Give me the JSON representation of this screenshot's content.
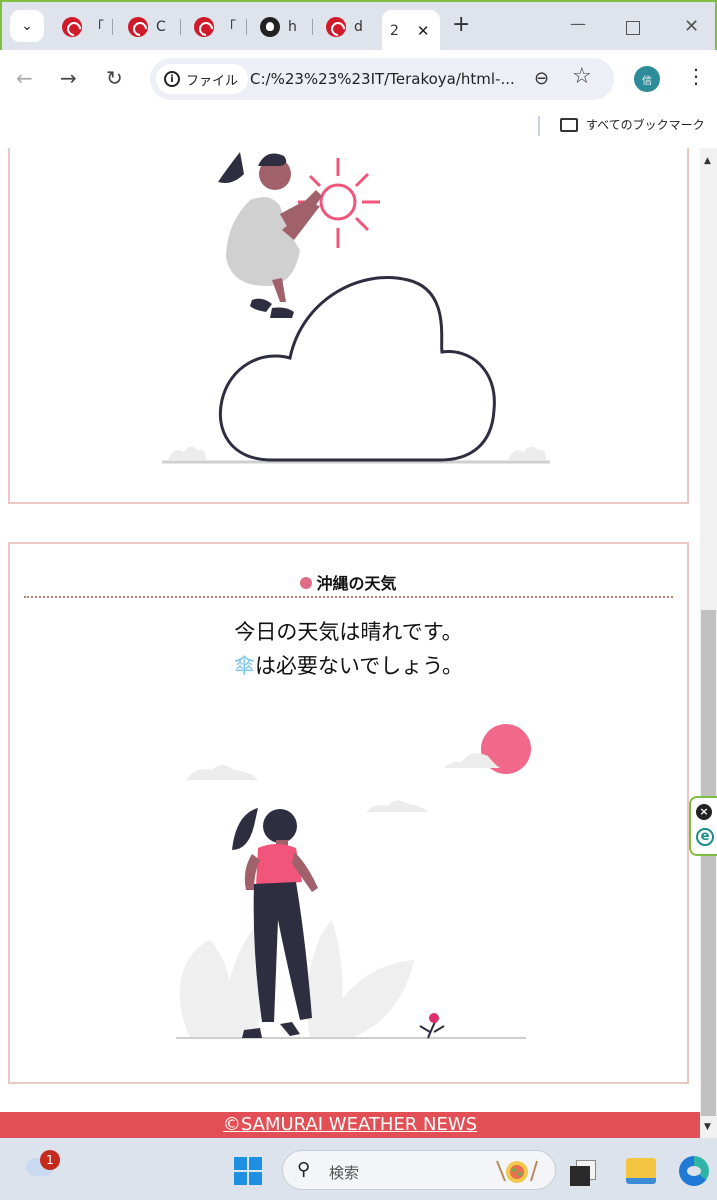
{
  "browser": {
    "tabs": [
      {
        "icon": "samurai-favicon",
        "label": "「"
      },
      {
        "icon": "samurai-favicon",
        "label": "C"
      },
      {
        "icon": "samurai-favicon",
        "label": "「"
      },
      {
        "icon": "github-favicon",
        "label": "h"
      },
      {
        "icon": "samurai-favicon",
        "label": "d"
      },
      {
        "icon": "",
        "label": "2",
        "active": true
      }
    ],
    "address": {
      "chip_label": "ファイル",
      "url": "C:/%23%23%23IT/Terakoya/html-..."
    },
    "profile_initial": "信",
    "bookmarks_label": "すべてのブックマーク"
  },
  "page": {
    "okinawa": {
      "title": "沖縄の天気",
      "line1": "今日の天気は晴れです。",
      "line2_icon": "傘",
      "line2_text": "は必要ないでしょう。"
    },
    "footer": "©SAMURAI WEATHER NEWS"
  },
  "taskbar": {
    "weather_badge": "1",
    "search_placeholder": "検索"
  },
  "colors": {
    "accent_pink": "#e06b84",
    "footer_red": "#e24f55",
    "card_border": "#ecc7c3",
    "umbrella_blue": "#7bc4e8"
  }
}
